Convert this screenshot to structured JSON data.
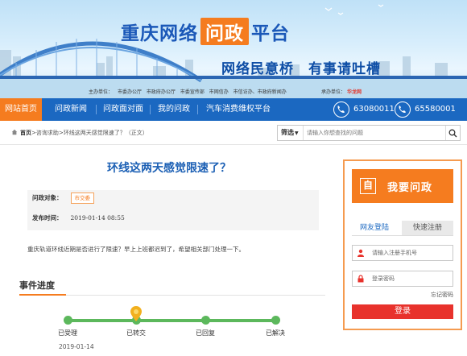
{
  "banner": {
    "title_pre": "重庆网络",
    "title_highlight": "问政",
    "title_post": "平台",
    "slogan": "网络民意桥　有事请吐槽",
    "sponsor_label": "主办单位：",
    "sponsors": [
      "市委办公厅",
      "市政府办公厅",
      "市委宣传部",
      "市网信办",
      "市信访办、市政府新闻办"
    ],
    "undertake_label": "承办单位：",
    "undertake_logo": "华龙网"
  },
  "nav": {
    "items": [
      "网站首页",
      "问政新闻",
      "问政面对面",
      "我的问政",
      "汽车消费维权平台"
    ],
    "phone1": "63080011",
    "phone2": "65580001"
  },
  "breadcrumb": {
    "home": "首页",
    "path": ">咨询求助>环线这两天感觉限速了？（正文）"
  },
  "search": {
    "filter_label": "筛选",
    "placeholder": "请输入你想查找的问题"
  },
  "question": {
    "title": "环线这两天感觉限速了？",
    "target_label": "问政对象：",
    "target_value": "市交委",
    "time_label": "发布时间：",
    "time_value": "2019-01-14 08:55",
    "body": "重庆轨道环线近期是否进行了限速？早上上班都迟到了，希望相关部门处理一下。"
  },
  "progress": {
    "heading": "事件进度",
    "stages": [
      "已受理",
      "已转交",
      "已回复",
      "已解决"
    ],
    "accepted_date": "2019-01-14",
    "current_stage_index": 1
  },
  "panel": {
    "ask_icon": "自",
    "ask_label": "我要问政",
    "tab_login": "网友登陆",
    "tab_register": "快速注册",
    "phone_placeholder": "请输入注册手机号",
    "password_placeholder": "登录密码",
    "forgot": "忘记密码",
    "login_button": "登录"
  },
  "colors": {
    "brand_blue": "#1b68c1",
    "accent_orange": "#f57c1f",
    "progress_green": "#5cb85c",
    "login_red": "#e8322c"
  }
}
